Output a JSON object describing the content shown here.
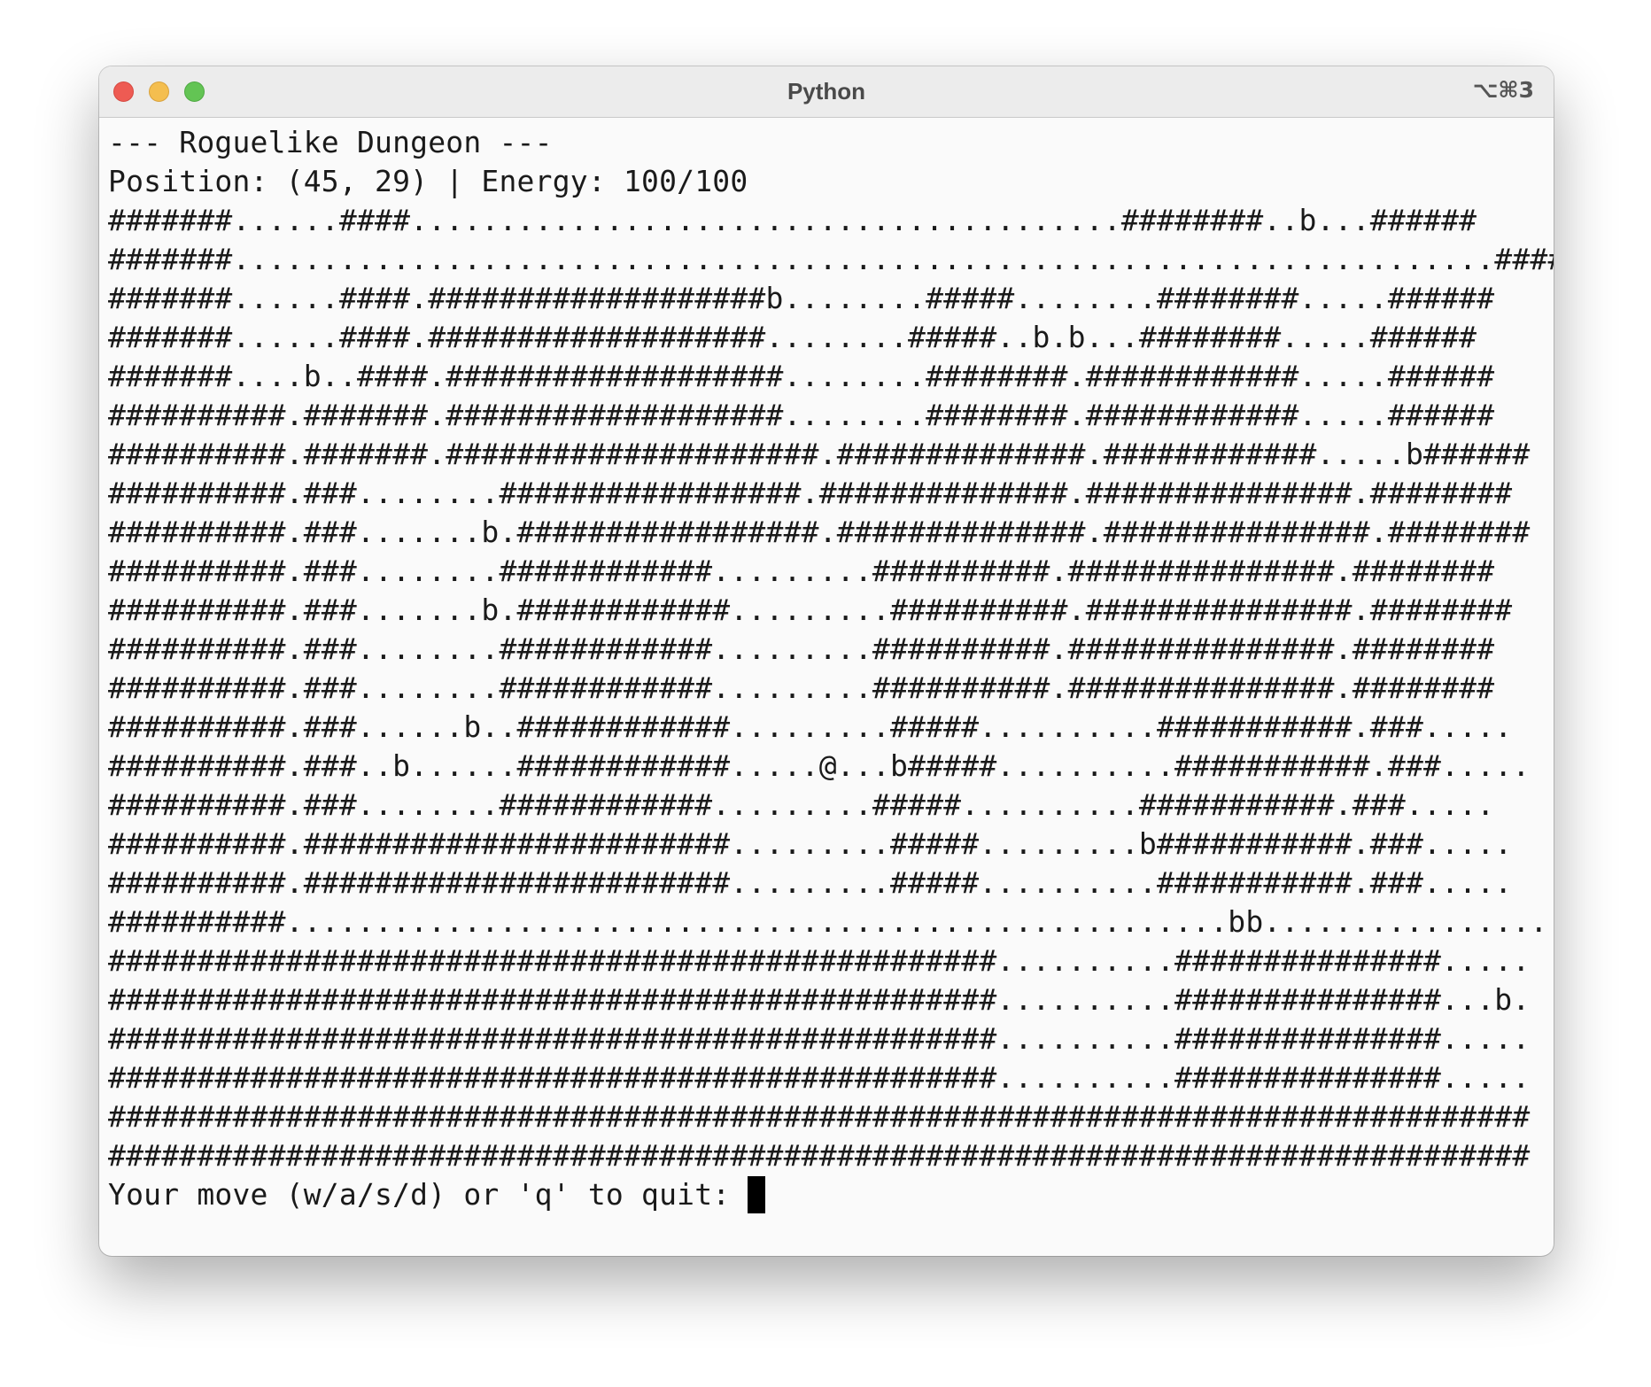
{
  "window": {
    "title": "Python",
    "shortcut": "⌥⌘3"
  },
  "terminal": {
    "header": "--- Roguelike Dungeon ---",
    "status": "Position: (45, 29) | Energy: 100/100",
    "map_rows": [
      "#######......####........................................########..b...######",
      "#######.......................................................................######",
      "#######......####.###################b........#####........########.....######",
      "#######......####.###################........#####..b.b...########.....######",
      "#######....b..####.###################........########.############.....######",
      "##########.#######.###################........########.############.....######",
      "##########.#######.#####################.##############.############.....b######",
      "##########.###........#################.##############.###############.########",
      "##########.###.......b.#################.##############.###############.########",
      "##########.###........############.........##########.###############.########",
      "##########.###.......b.############.........##########.###############.########",
      "##########.###........############.........##########.###############.########",
      "##########.###........############.........##########.###############.########",
      "##########.###......b..############.........#####..........###########.###.....",
      "##########.###..b......############.....@...b#####..........###########.###.....",
      "##########.###........############.........#####..........###########.###.....",
      "##########.########################.........#####.........b###########.###.....",
      "##########.########################.........#####..........###########.###.....",
      "##########.....................................................bb..................",
      "##################################################..........###############.....",
      "##################################################..........###############...b.",
      "##################################################..........###############.....",
      "##################################################..........###############.....",
      "################################################################################",
      "################################################################################"
    ],
    "prompt": "Your move (w/a/s/d) or 'q' to quit: "
  }
}
